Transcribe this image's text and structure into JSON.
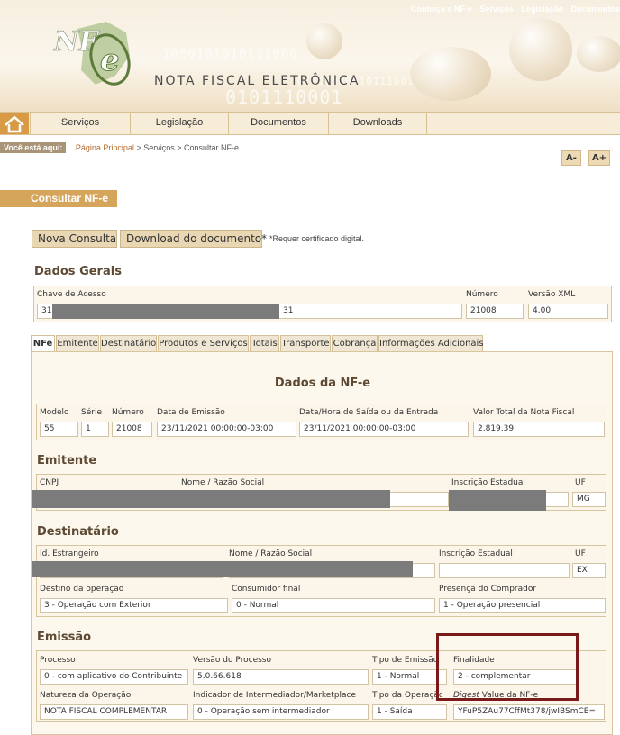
{
  "header": {
    "top_links": [
      "Conheça a NF-e",
      "Serviços",
      "Legislação",
      "Documentos"
    ],
    "brand_text": "NOTA FISCAL ELETRÔNICA",
    "logo_text": "NF-e",
    "binary_strings": [
      "1000101010111000",
      "01110000010111001",
      "0101110001"
    ]
  },
  "nav": {
    "items": [
      "Serviços",
      "Legislação",
      "Documentos",
      "Downloads"
    ]
  },
  "breadcrumb": {
    "label": "Você está aqui:",
    "home": "Página Principal",
    "sep": ">",
    "services": "Serviços",
    "current": "Consultar NF-e"
  },
  "font_controls": {
    "decrease": "A-",
    "increase": "A+"
  },
  "page_title": "Consultar NF-e",
  "actions": {
    "new_query": "Nova Consulta",
    "download": "Download do documento*",
    "note": "*Requer certificado digital."
  },
  "dados_gerais": {
    "title": "Dados Gerais",
    "chave_label": "Chave de Acesso",
    "chave_prefix": "31",
    "chave_suffix": "31",
    "numero_label": "Número",
    "numero": "21008",
    "versao_label": "Versão XML",
    "versao": "4.00"
  },
  "tabs": [
    "NFe",
    "Emitente",
    "Destinatário",
    "Produtos e Serviços",
    "Totais",
    "Transporte",
    "Cobrança",
    "Informações Adicionais"
  ],
  "dados_nfe": {
    "title": "Dados da NF-e",
    "labels": [
      "Modelo",
      "Série",
      "Número",
      "Data de Emissão",
      "Data/Hora de Saída ou da Entrada",
      "Valor Total da Nota Fiscal"
    ],
    "values": [
      "55",
      "1",
      "21008",
      "23/11/2021 00:00:00-03:00",
      "23/11/2021 00:00:00-03:00",
      "2.819,39"
    ]
  },
  "emitente": {
    "title": "Emitente",
    "labels": [
      "CNPJ",
      "Nome / Razão Social",
      "Inscrição Estadual",
      "UF"
    ],
    "uf": "MG"
  },
  "destinatario": {
    "title": "Destinatário",
    "labels": [
      "Id. Estrangeiro",
      "Nome / Razão Social",
      "Inscrição Estadual",
      "UF"
    ],
    "uf": "EX",
    "labels2": [
      "Destino da operação",
      "Consumidor final",
      "Presença do Comprador"
    ],
    "values2": [
      "3 - Operação com Exterior",
      "0 - Normal",
      "1 - Operação presencial"
    ]
  },
  "emissao": {
    "title": "Emissão",
    "labels": [
      "Processo",
      "Versão do Processo",
      "Tipo de Emissão",
      "Finalidade"
    ],
    "values": [
      "0 - com aplicativo do Contribuinte",
      "5.0.66.618",
      "1 - Normal",
      "2 - complementar"
    ],
    "labels2": [
      "Natureza da Operação",
      "Indicador de Intermediador/Marketplace",
      "Tipo da Operação",
      "Value da NF-e"
    ],
    "digest_label": "Digest",
    "values2": [
      "NOTA FISCAL COMPLEMENTAR",
      "0 - Operação sem intermediador",
      "1 - Saída",
      "YFuP5ZAu77CffMt378/jwIBSmCE="
    ]
  },
  "colors": {
    "accent": "#d6a55c",
    "highlight_border": "#7a1a1a",
    "section_title": "#5e4a33"
  }
}
